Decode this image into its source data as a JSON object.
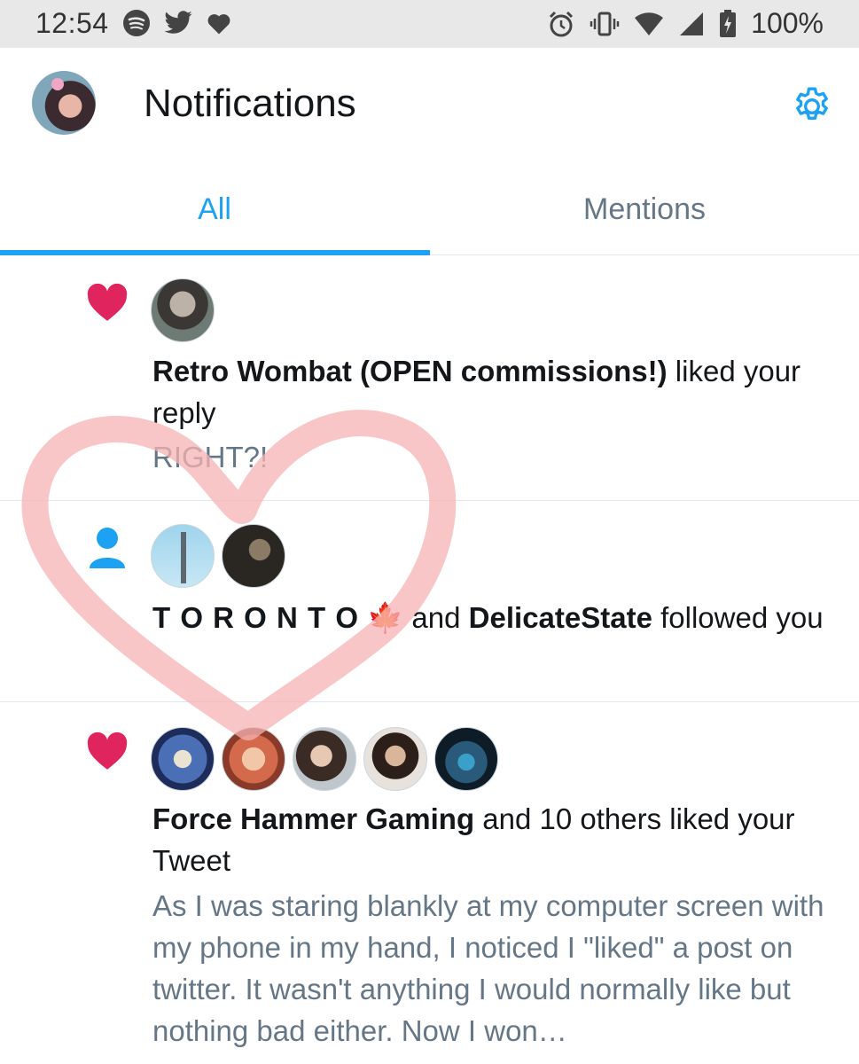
{
  "status_bar": {
    "time": "12:54",
    "left_icons": [
      "spotify-icon",
      "twitter-icon",
      "heart-icon"
    ],
    "right_icons": [
      "alarm-icon",
      "vibrate-icon",
      "wifi-icon",
      "signal-icon",
      "battery-icon"
    ],
    "battery": "100%"
  },
  "header": {
    "title": "Notifications",
    "accent": "#1da1f2"
  },
  "tabs": [
    {
      "label": "All",
      "active": true
    },
    {
      "label": "Mentions",
      "active": false
    }
  ],
  "colors": {
    "like": "#e0245e",
    "follow": "#1da1f2",
    "secondary_text": "#657786",
    "overlay": "#f6b3b3"
  },
  "notifications": [
    {
      "type": "like",
      "icon": "heart-icon",
      "actor": "Retro Wombat (OPEN commissions!)",
      "action": " liked your reply",
      "preview": "RIGHT?!",
      "avatars": [
        "retro-wombat"
      ]
    },
    {
      "type": "follow",
      "icon": "person-icon",
      "actor": "T O R O N T O",
      "actor_emoji": "🍁",
      "conjunction": " and ",
      "actor2": "DelicateState",
      "action": " followed you",
      "avatars": [
        "toronto",
        "delicatestate"
      ]
    },
    {
      "type": "like",
      "icon": "heart-icon",
      "actor": "Force Hammer Gaming",
      "action": " and 10 others liked your Tweet",
      "preview": "As I was staring blankly at my computer screen with my phone in my hand, I noticed I \"liked\" a post on twitter. It wasn't anything I would normally like but nothing bad either. Now I won…",
      "avatars": [
        "force-hammer-gaming",
        "user-2",
        "user-3",
        "user-4",
        "user-5"
      ]
    }
  ]
}
